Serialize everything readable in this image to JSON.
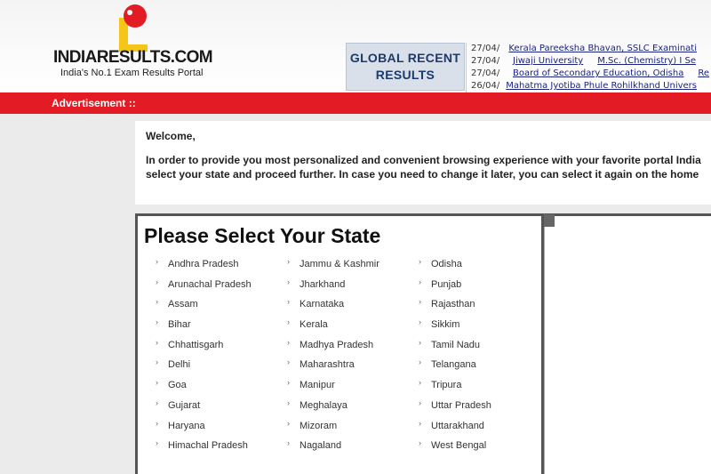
{
  "header": {
    "logo_text": "INDIARESULTS.COM",
    "logo_tagline": "India's No.1 Exam Results Portal",
    "global_recent": [
      "GLOBAL RECENT",
      "RESULTS"
    ],
    "ticker": [
      {
        "date": "27/04/",
        "org": "Kerala Pareeksha Bhavan, SSLC Examinati",
        "course": ""
      },
      {
        "date": "27/04/",
        "org": "Jiwaji University",
        "course": "M.Sc. (Chemistry) I Se"
      },
      {
        "date": "27/04/",
        "org": "Board of Secondary Education, Odisha",
        "course": "Re"
      },
      {
        "date": "26/04/",
        "org": "Mahatma Jyotiba Phule Rohilkhand Univers",
        "course": ""
      }
    ]
  },
  "adbar": {
    "label": "Advertisement ::"
  },
  "welcome": {
    "title": "Welcome,",
    "line1": "In order to provide you most personalized and convenient browsing experience with your favorite portal India",
    "line2": "select your state and proceed further. In case you need to change it later, you can select it again on the home"
  },
  "state_select": {
    "title": "Please Select Your State",
    "columns": [
      [
        "Andhra Pradesh",
        "Arunachal Pradesh",
        "Assam",
        "Bihar",
        "Chhattisgarh",
        "Delhi",
        "Goa",
        "Gujarat",
        "Haryana",
        "Himachal Pradesh"
      ],
      [
        "Jammu & Kashmir",
        "Jharkhand",
        "Karnataka",
        "Kerala",
        "Madhya Pradesh",
        "Maharashtra",
        "Manipur",
        "Meghalaya",
        "Mizoram",
        "Nagaland"
      ],
      [
        "Odisha",
        "Punjab",
        "Rajasthan",
        "Sikkim",
        "Tamil Nadu",
        "Telangana",
        "Tripura",
        "Uttar Pradesh",
        "Uttarakhand",
        "West Bengal"
      ]
    ]
  },
  "colors": {
    "brand_red": "#e21b25",
    "logo_yellow": "#f5c518",
    "link_blue": "#1a237e",
    "box_text": "#1c3a6a"
  }
}
